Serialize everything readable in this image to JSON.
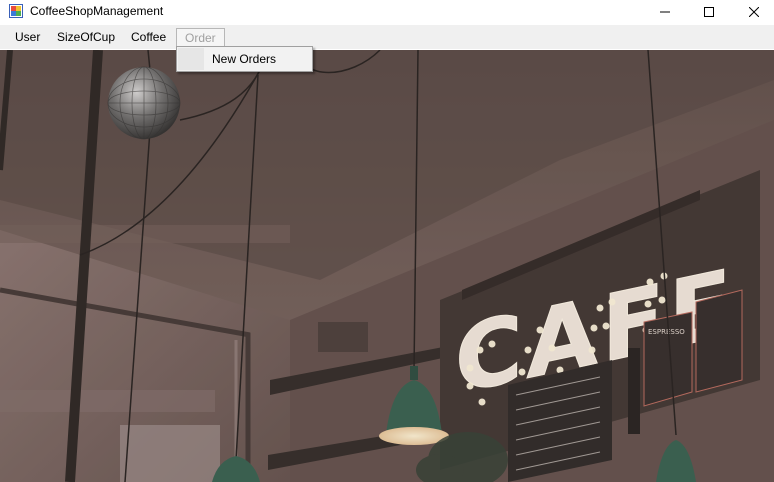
{
  "window": {
    "title": "CoffeeShopManagement",
    "icon": "winforms-app-icon",
    "controls": [
      "minimize-icon",
      "maximize-icon",
      "close-icon"
    ]
  },
  "menubar": {
    "items": [
      {
        "label": "User"
      },
      {
        "label": "SizeOfCup"
      },
      {
        "label": "Coffee"
      },
      {
        "label": "Order",
        "state": "open"
      }
    ]
  },
  "dropdown": {
    "items": [
      {
        "label": "New Orders"
      }
    ]
  },
  "background": {
    "sign_text": "CAFE",
    "menu_board_heading": "ESPRESSO",
    "colors": {
      "wall": "#6b5550",
      "ceiling": "#5a4944",
      "shelf": "#2a2422",
      "lamp": "#2e5a4a",
      "bulb": "#f6e3b8"
    }
  }
}
